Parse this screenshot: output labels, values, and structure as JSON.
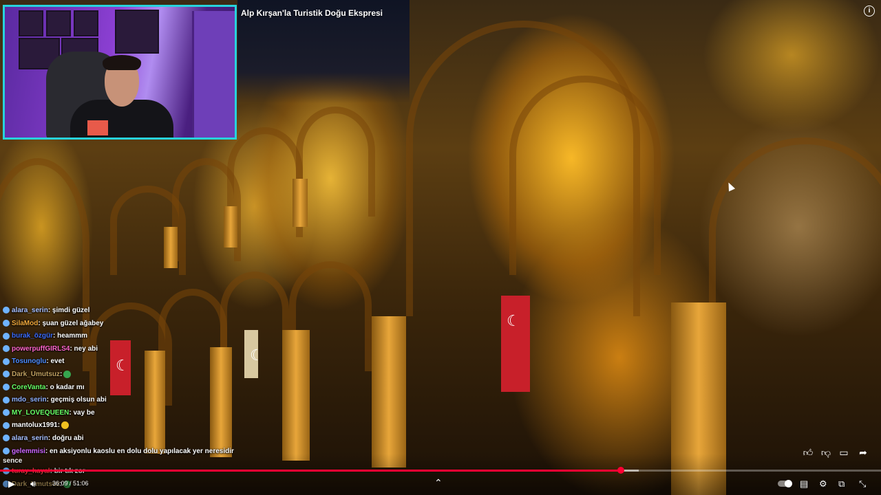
{
  "video": {
    "title": "Alp Kırşan'la Turistik Doğu Ekspresi",
    "current_time": "36:09 / 51:06",
    "progress_fraction": 0.705,
    "buffer_fraction": 0.725
  },
  "chat": {
    "messages": [
      {
        "user": "alara_serin",
        "text": ": şimdi güzel",
        "color": "#a8c0ff"
      },
      {
        "user": "SilaMod",
        "text": ": şuan güzel ağabey",
        "color": "#f2a93b"
      },
      {
        "user": "burak_özgür",
        "text": ": heammm",
        "color": "#3b6cff"
      },
      {
        "user": "powerpuffGIRLS4",
        "text": ": ney abi",
        "color": "#ff66cc"
      },
      {
        "user": "Tosunoglu",
        "text": ": evet",
        "color": "#4d8cff"
      },
      {
        "user": "Dark_Umutsuz",
        "text": ":",
        "color": "#c0a060"
      },
      {
        "user": "CoreVanta",
        "text": ": o kadar mı",
        "color": "#66ff66"
      },
      {
        "user": "mdo_serin",
        "text": ": geçmiş olsun abi",
        "color": "#8fb0ff"
      },
      {
        "user": "MY_LOVEQUEEN",
        "text": ": vay be",
        "color": "#66ff66"
      },
      {
        "user": "mantolux1991",
        "text": ":",
        "color": "#ffffff"
      },
      {
        "user": "alara_serin",
        "text": ": doğru abi",
        "color": "#a8c0ff"
      },
      {
        "user": "gelemmisi",
        "text": ": en aksiyonlu kaoslu en dolu dolu yapılacak yer neresidir",
        "color": "#cc66ff"
      },
      {
        "user": "turay_hayal",
        "text": ": bir tık zor",
        "color": "#ff4444"
      },
      {
        "user": "Dark_Umutsuz",
        "text": ":",
        "color": "#c0a060"
      }
    ],
    "continuation": "sence"
  },
  "icons": {
    "info": "info-icon",
    "like": "thumbs-up-icon",
    "dislike": "thumbs-down-icon",
    "comment": "comment-icon",
    "share": "share-icon",
    "play": "play-icon",
    "volume": "volume-icon",
    "subtitles": "subtitles-icon",
    "settings": "gear-icon",
    "cast": "cast-icon",
    "fullscreen": "fullscreen-icon"
  },
  "colors": {
    "accent": "#ff0033",
    "webcam_border": "#27d3dc"
  }
}
